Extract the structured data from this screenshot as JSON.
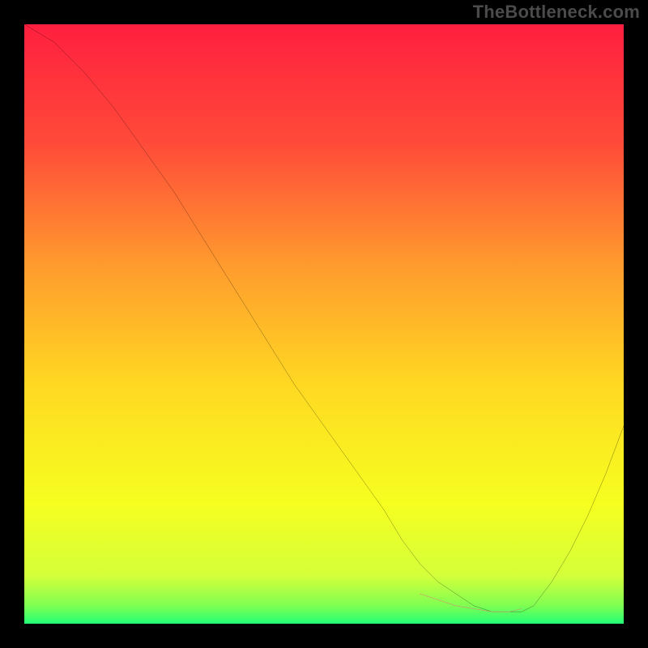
{
  "watermark": "TheBottleneck.com",
  "chart_data": {
    "type": "line",
    "title": "",
    "xlabel": "",
    "ylabel": "",
    "xlim": [
      0,
      100
    ],
    "ylim": [
      0,
      100
    ],
    "grid": false,
    "legend": false,
    "background": {
      "type": "vertical-gradient",
      "stops": [
        {
          "pos": 0.0,
          "color": "#ff1f3f"
        },
        {
          "pos": 0.2,
          "color": "#ff4b39"
        },
        {
          "pos": 0.4,
          "color": "#ff9a2e"
        },
        {
          "pos": 0.6,
          "color": "#ffd822"
        },
        {
          "pos": 0.8,
          "color": "#f6ff20"
        },
        {
          "pos": 0.92,
          "color": "#d4ff3a"
        },
        {
          "pos": 0.97,
          "color": "#7fff52"
        },
        {
          "pos": 1.0,
          "color": "#22ff77"
        }
      ]
    },
    "curve": {
      "name": "bottleneck",
      "color": "#000000",
      "width": 1.6,
      "x": [
        0,
        5,
        10,
        15,
        20,
        25,
        30,
        35,
        40,
        45,
        50,
        55,
        60,
        63,
        66,
        69,
        72,
        75,
        78,
        81,
        83,
        85,
        88,
        91,
        94,
        97,
        100
      ],
      "y": [
        100,
        97,
        92,
        86,
        79,
        72,
        64,
        56,
        48,
        40,
        33,
        26,
        19,
        14,
        10,
        7,
        5,
        3,
        2,
        2,
        2,
        3,
        7,
        12,
        18,
        25,
        33
      ]
    },
    "highlight_band": {
      "name": "optimal-range-band",
      "color": "#e07a7a",
      "dash": "4 3",
      "segments": [
        {
          "x": [
            66,
            69,
            72,
            75,
            78,
            81,
            83
          ],
          "y": [
            5,
            4,
            3,
            2.5,
            2,
            2,
            2.5
          ]
        }
      ]
    }
  }
}
